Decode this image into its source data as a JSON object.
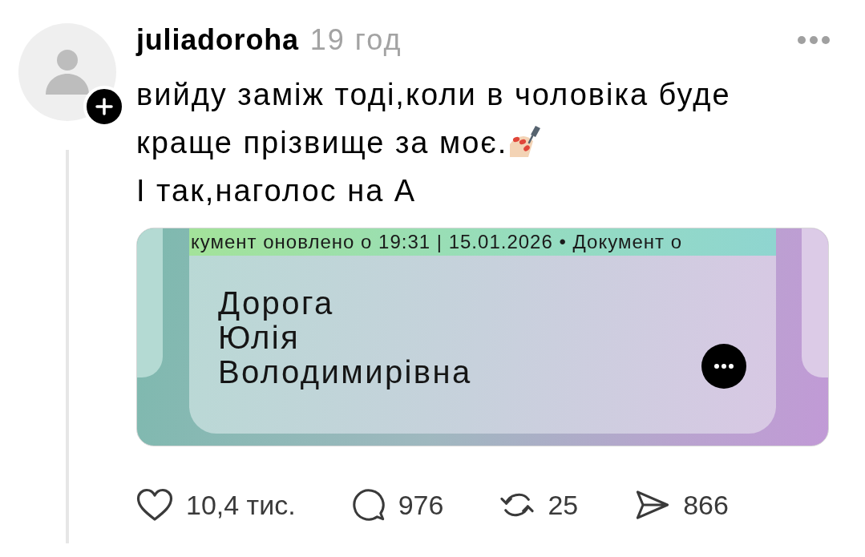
{
  "post": {
    "following": false,
    "username": "juliadoroha",
    "time": "19 год",
    "lines": [
      {
        "text": "вийду заміж тоді,коли в чоловіка буде",
        "ends_with_emoji": false
      },
      {
        "text": "краще прізвище за моє.",
        "ends_with_emoji": true
      },
      {
        "text": "І так,наголос на А",
        "ends_with_emoji": false
      }
    ],
    "attachment": {
      "banner": "кумент оновлено о 19:31 | 15.01.2026 • Документ о",
      "name_lines": [
        "Дорога",
        "Юлія",
        "Володимирівна"
      ]
    },
    "actions": [
      {
        "kind": "like",
        "count": "10,4 тис.",
        "active": false
      },
      {
        "kind": "reply",
        "count": "976",
        "active": false
      },
      {
        "kind": "repost",
        "count": "25",
        "active": false
      },
      {
        "kind": "share",
        "count": "866",
        "active": false
      }
    ]
  }
}
